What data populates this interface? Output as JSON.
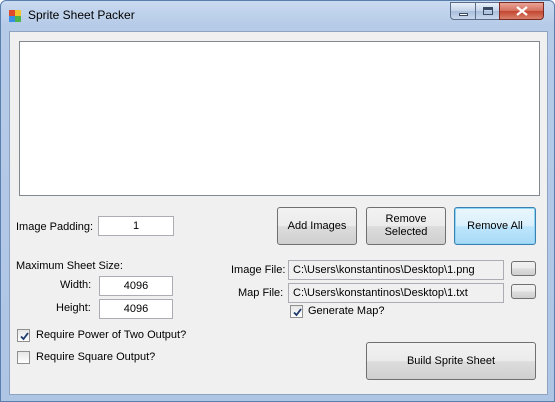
{
  "window": {
    "title": "Sprite Sheet Packer"
  },
  "padding": {
    "label": "Image Padding:",
    "value": "1"
  },
  "buttons": {
    "add": "Add Images",
    "remove_selected": "Remove Selected",
    "remove_all": "Remove All",
    "build": "Build Sprite Sheet",
    "browse": ""
  },
  "max_size": {
    "label": "Maximum Sheet Size:",
    "width_label": "Width:",
    "width_value": "4096",
    "height_label": "Height:",
    "height_value": "4096"
  },
  "image_file": {
    "label": "Image File:",
    "value": "C:\\Users\\konstantinos\\Desktop\\1.png"
  },
  "map_file": {
    "label": "Map File:",
    "value": "C:\\Users\\konstantinos\\Desktop\\1.txt"
  },
  "options": {
    "generate_map": {
      "label": "Generate Map?",
      "checked": true
    },
    "power_of_two": {
      "label": "Require Power of Two Output?",
      "checked": true
    },
    "square": {
      "label": "Require Square Output?",
      "checked": false
    }
  },
  "icons": {
    "app": "app-icon",
    "minimize": "minimize-icon",
    "maximize": "maximize-icon",
    "close": "close-icon",
    "check": "checkmark-icon"
  },
  "colors": {
    "title_bar": "#b9cde9",
    "client_bg": "#f0f0f0",
    "focus_button": "#3c7fb1",
    "close_button": "#c44630"
  }
}
